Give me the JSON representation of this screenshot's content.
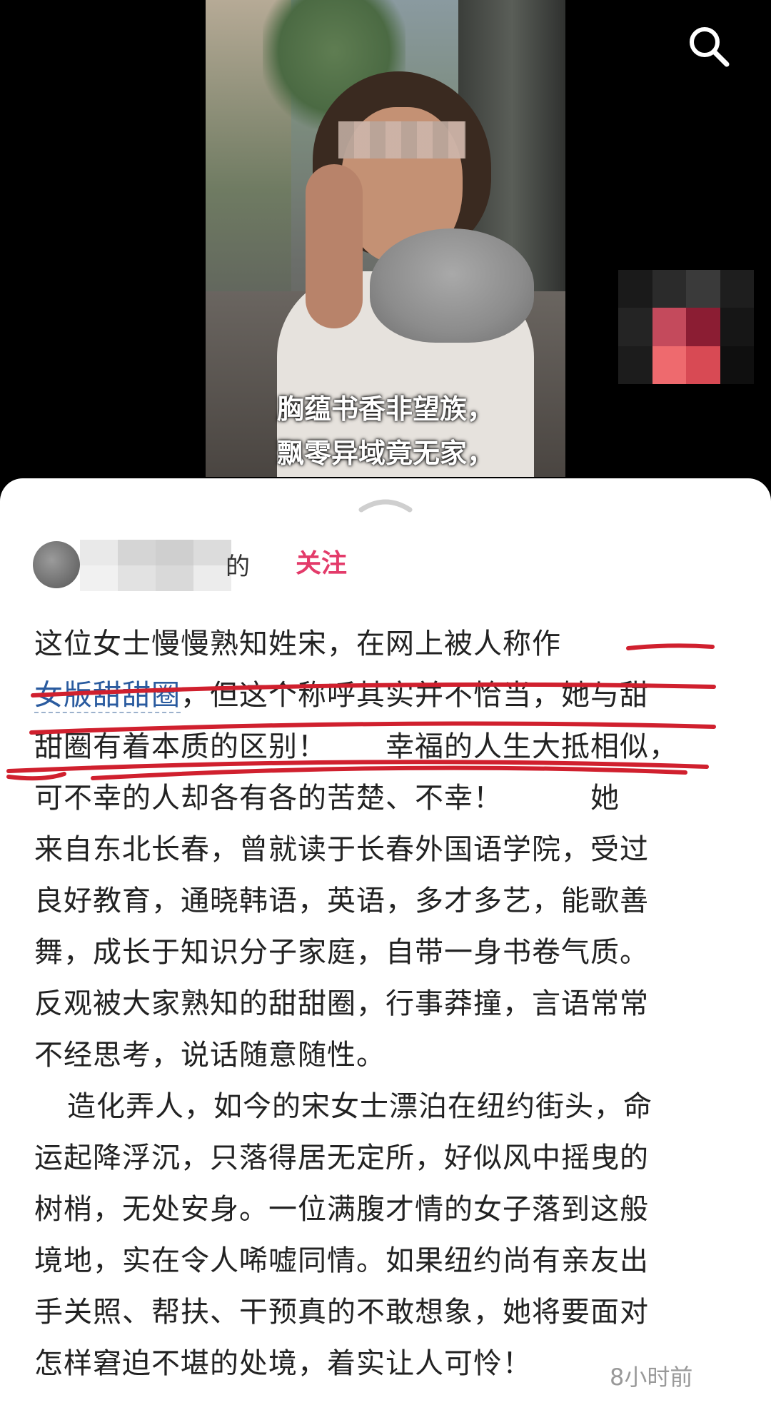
{
  "video": {
    "caption_line1": "胸蕴书香非望族，",
    "caption_line2": "飘零异域竟无家，"
  },
  "icons": {
    "search": "search-icon",
    "handle": "chevron-up-icon"
  },
  "post": {
    "author_suffix": "的",
    "follow_label": "关注",
    "para1": {
      "l1": "这位女士慢慢熟知姓宋，在网上被人称作",
      "link": "女版甜甜圈",
      "l2_rest": "，但这个称呼其实并不恰当，她与甜",
      "l3": "甜圈有着本质的区别！　　幸福的人生大抵相似，",
      "l4": "可不幸的人却各有各的苦楚、不幸！　　　她",
      "l5": "来自东北长春，曾就读于长春外国语学院，受过",
      "l6": "良好教育，通晓韩语，英语，多才多艺，能歌善",
      "l7": "舞，成长于知识分子家庭，自带一身书卷气质。",
      "l8": "反观被大家熟知的甜甜圈，行事莽撞，言语常常",
      "l9": "不经思考，说话随意随性。"
    },
    "para2": {
      "l1": "造化弄人，如今的宋女士漂泊在纽约街头，命",
      "l2": "运起降浮沉，只落得居无定所，好似风中摇曳的",
      "l3": "树梢，无处安身。一位满腹才情的女子落到这般",
      "l4": "境地，实在令人唏嘘同情。如果纽约尚有亲友出",
      "l5": "手关照、帮扶、干预真的不敢想象，她将要面对",
      "l6": "怎样窘迫不堪的处境，着实让人可怜！"
    },
    "timestamp": "8小时前"
  },
  "colors": {
    "follow": "#e33b6a",
    "link": "#2a5b9f",
    "underline_ink": "#d0202e"
  }
}
